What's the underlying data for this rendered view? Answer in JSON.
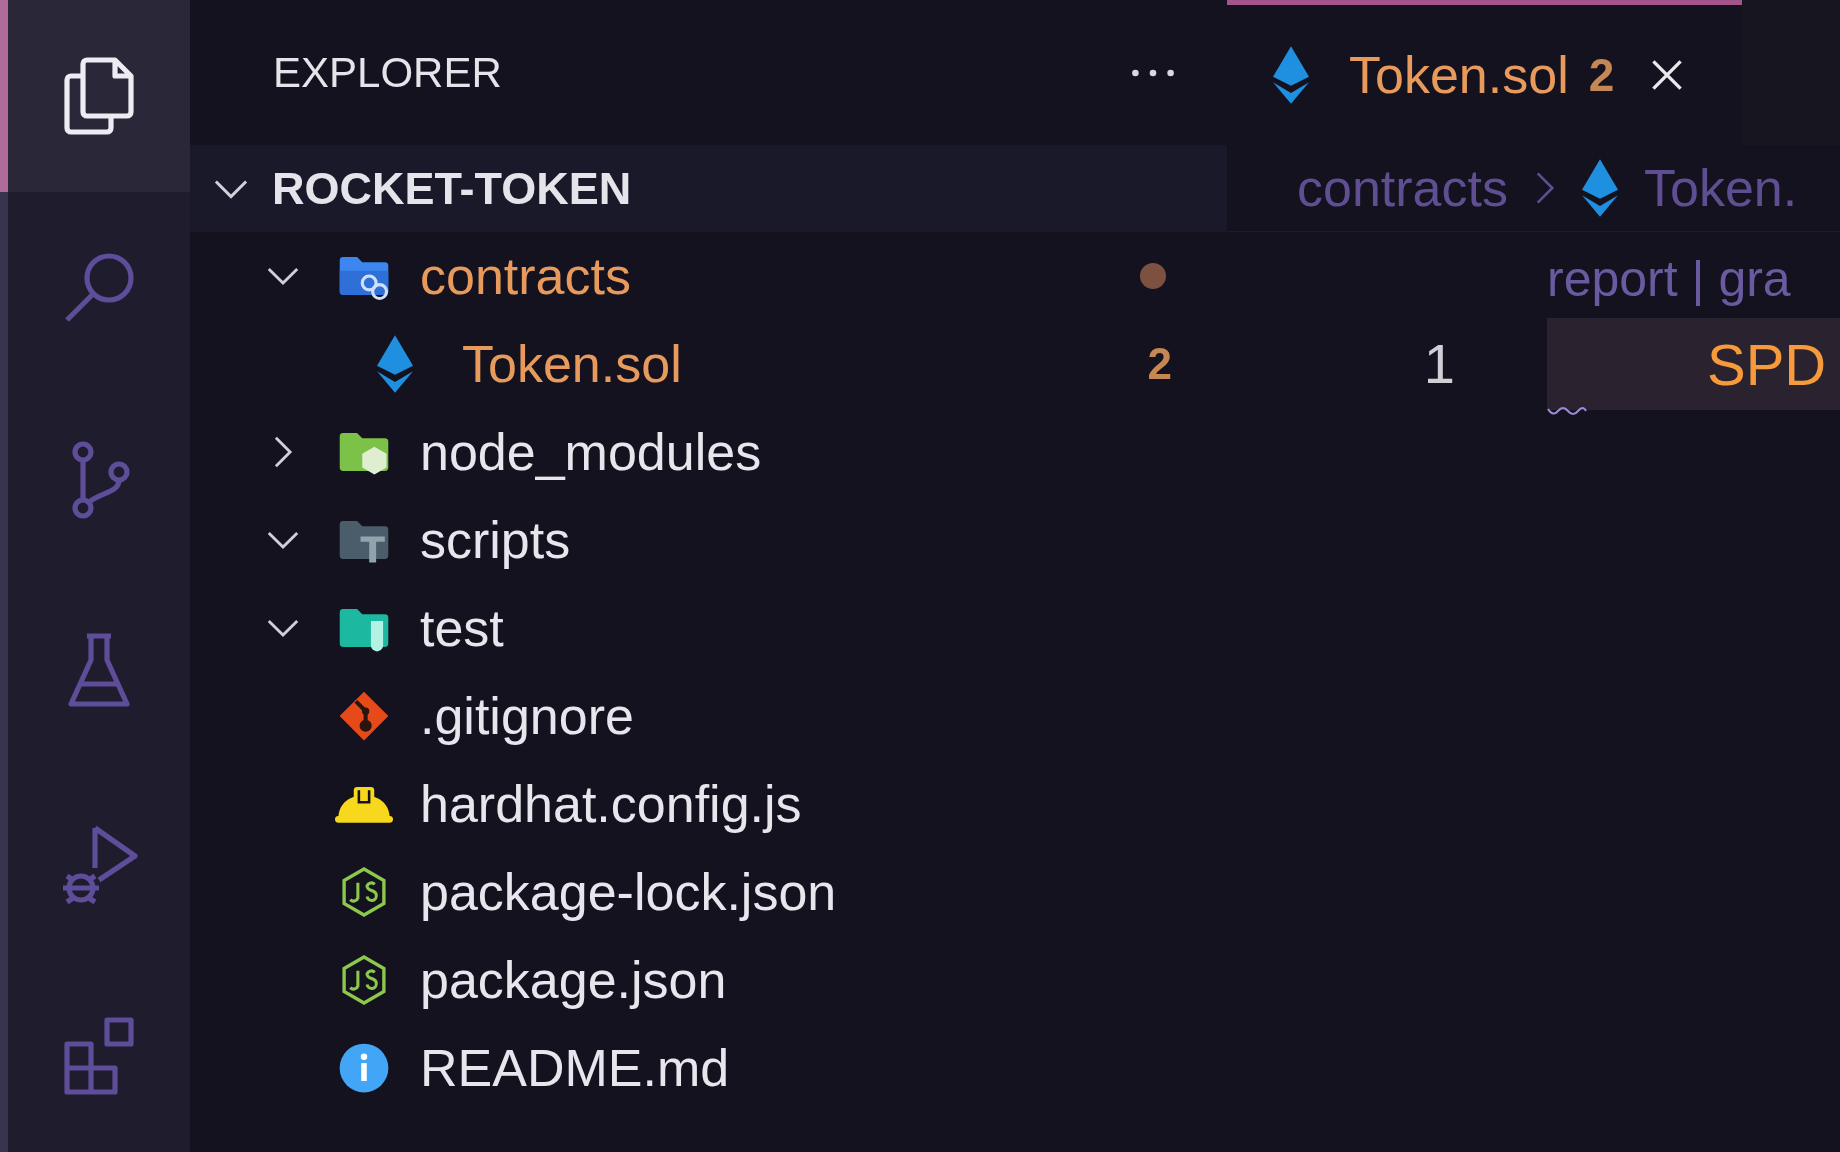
{
  "activity_bar": {
    "items": [
      {
        "kind": "explorer",
        "selected": true
      },
      {
        "kind": "search",
        "selected": false
      },
      {
        "kind": "source-control",
        "selected": false
      },
      {
        "kind": "testing",
        "selected": false
      },
      {
        "kind": "run-debug",
        "selected": false
      },
      {
        "kind": "extensions",
        "selected": false
      }
    ]
  },
  "sidebar": {
    "title": "EXPLORER",
    "project": {
      "label": "ROCKET-TOKEN",
      "expanded": true,
      "items": [
        {
          "label": "contracts",
          "kind": "folder-contracts",
          "expanded": true,
          "warning": true,
          "decoration": {
            "kind": "dot"
          },
          "children": [
            {
              "label": "Token.sol",
              "kind": "solidity",
              "warning": true,
              "decoration": {
                "kind": "count",
                "text": "2"
              }
            }
          ]
        },
        {
          "label": "node_modules",
          "kind": "folder-node",
          "expanded": false,
          "warning": false
        },
        {
          "label": "scripts",
          "kind": "folder-scripts",
          "expanded": true,
          "warning": false
        },
        {
          "label": "test",
          "kind": "folder-test",
          "expanded": true,
          "warning": false
        },
        {
          "label": ".gitignore",
          "kind": "git",
          "warning": false
        },
        {
          "label": "hardhat.config.js",
          "kind": "hardhat",
          "warning": false
        },
        {
          "label": "package-lock.json",
          "kind": "nodejs",
          "warning": false
        },
        {
          "label": "package.json",
          "kind": "nodejs",
          "warning": false
        },
        {
          "label": "README.md",
          "kind": "info",
          "warning": false
        }
      ]
    }
  },
  "editor": {
    "tabs": [
      {
        "label": "Token.sol",
        "kind": "solidity",
        "badge": "2",
        "warning": true,
        "selected": true
      }
    ],
    "breadcrumbs": [
      {
        "label": "contracts",
        "kind": "folder"
      },
      {
        "label": "Token.",
        "kind": "solidity"
      }
    ],
    "codelens": "report | gra",
    "lines": [
      {
        "number": "1",
        "text": "SPD",
        "current": true,
        "warning": true
      }
    ]
  }
}
